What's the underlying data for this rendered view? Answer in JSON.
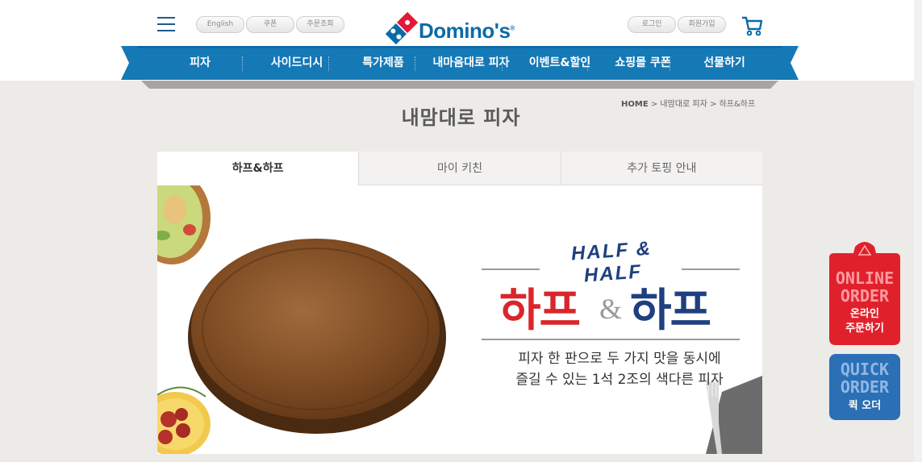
{
  "header": {
    "utility_left": [
      "English",
      "쿠폰",
      "주문조회"
    ],
    "utility_right": [
      "로그인",
      "회원가입"
    ],
    "logo_text": "Domino's",
    "logo_mark": "®"
  },
  "nav": {
    "items": [
      "피자",
      "사이드디시",
      "특가제품",
      "내마음대로 피자",
      "이벤트&할인",
      "쇼핑몰 쿠폰",
      "선물하기"
    ]
  },
  "breadcrumb": {
    "home": "HOME",
    "sep1": ">",
    "level1": "내맘대로 피자",
    "sep2": ">",
    "current": "하프&하프"
  },
  "page_title": "내맘대로 피자",
  "tabs": [
    {
      "label": "하프&하프",
      "active": true
    },
    {
      "label": "마이 키친",
      "active": false
    },
    {
      "label": "추가 토핑 안내",
      "active": false
    }
  ],
  "banner": {
    "eng_title": "HALF & HALF",
    "title_left": "하프",
    "title_amp": "&",
    "title_right": "하프",
    "desc_line1": "피자 한 판으로 두 가지 맛을 동시에",
    "desc_line2": "즐길 수 있는 1석 2조의 색다른 피자"
  },
  "side_buttons": {
    "online": {
      "en_line1": "ONLINE",
      "en_line2": "ORDER",
      "ko_line1": "온라인",
      "ko_line2": "주문하기"
    },
    "quick": {
      "en_line1": "QUICK",
      "en_line2": "ORDER",
      "ko_line1": "퀵 오더"
    }
  },
  "colors": {
    "brand_blue": "#0b6ba8",
    "nav_blue": "#1579b6",
    "brand_red": "#e31837",
    "title_red": "#d9262b",
    "title_navy": "#1f3f80",
    "online_red": "#e0212c",
    "quick_blue": "#2b6fb5"
  }
}
